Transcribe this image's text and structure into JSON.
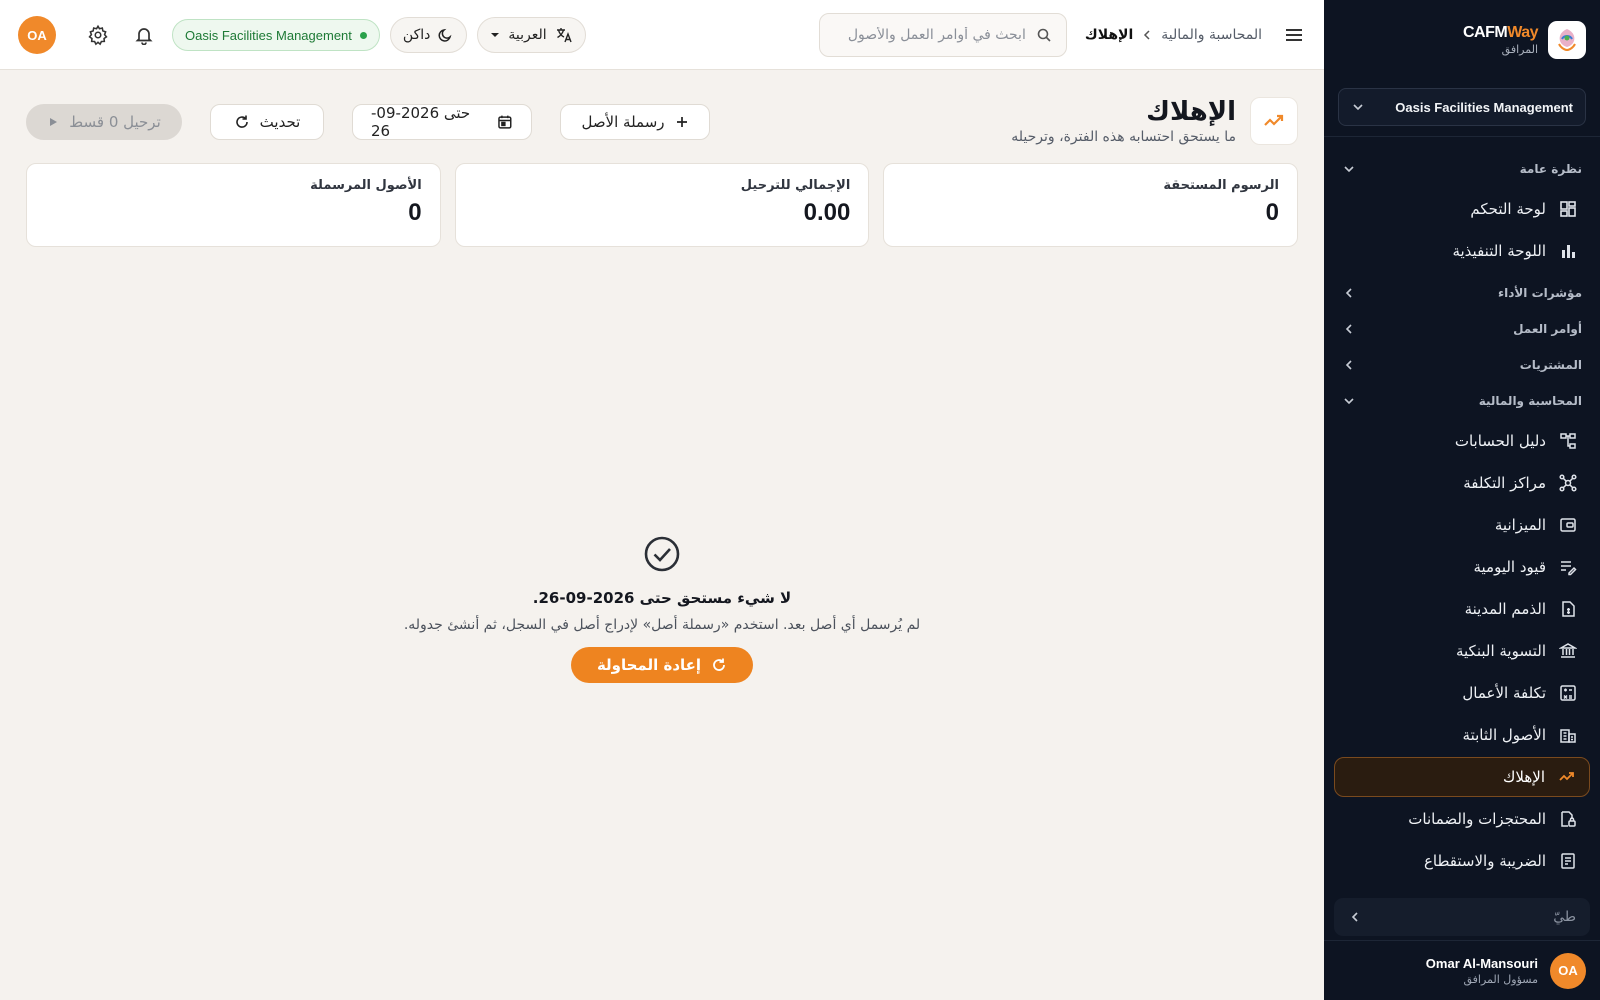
{
  "brand": {
    "name_part1": "CAFM",
    "name_part2": "Way",
    "subtitle": "المرافق"
  },
  "org": {
    "name": "Oasis Facilities Management"
  },
  "sidebar": {
    "sections": {
      "overview": "نظرة عامة",
      "kpis": "مؤشرات الأداء",
      "work_orders": "أوامر العمل",
      "procurement": "المشتريات",
      "accounting": "المحاسبة والمالية"
    },
    "overview_items": [
      {
        "label": "لوحة التحكم",
        "icon": "dashboard-grid-icon"
      },
      {
        "label": "اللوحة التنفيذية",
        "icon": "bar-chart-icon"
      }
    ],
    "accounting_items": [
      {
        "label": "دليل الحسابات",
        "icon": "account-tree-icon"
      },
      {
        "label": "مراكز التكلفة",
        "icon": "hub-network-icon"
      },
      {
        "label": "الميزانية",
        "icon": "wallet-icon"
      },
      {
        "label": "قيود اليومية",
        "icon": "journal-edit-icon"
      },
      {
        "label": "الذمم المدينة",
        "icon": "receivable-doc-icon"
      },
      {
        "label": "التسوية البنكية",
        "icon": "bank-icon"
      },
      {
        "label": "تكلفة الأعمال",
        "icon": "calculator-icon"
      },
      {
        "label": "الأصول الثابتة",
        "icon": "building-icon"
      },
      {
        "label": "الإهلاك",
        "icon": "trending-down-icon",
        "active": true
      },
      {
        "label": "المحتجزات والضمانات",
        "icon": "lock-doc-icon"
      },
      {
        "label": "الضريبة والاستقطاع",
        "icon": "tax-icon"
      }
    ],
    "collapse_label": "طيّ",
    "user": {
      "name": "Omar Al-Mansouri",
      "role": "مسؤول المرافق",
      "initials": "OA"
    }
  },
  "topbar": {
    "breadcrumb_parent": "المحاسبة والمالية",
    "breadcrumb_current": "الإهلاك",
    "search_placeholder": "ابحث في أوامر العمل والأصول ...",
    "language": "العربية",
    "theme": "داكن",
    "org_badge": "Oasis Facilities Management",
    "user_initials": "OA"
  },
  "page": {
    "title": "الإهلاك",
    "subtitle": "ما يستحق احتسابه هذه الفترة، وترحيله",
    "actions": {
      "add_asset": "رسملة الأصل",
      "date_filter": "حتى 2026-09-26",
      "refresh": "تحديث",
      "post": "ترحيل 0 قسط"
    },
    "stats": [
      {
        "label": "الرسوم المستحقة",
        "value": "0"
      },
      {
        "label": "الإجمالي للترحيل",
        "value": "0.00"
      },
      {
        "label": "الأصول المرسملة",
        "value": "0"
      }
    ],
    "empty": {
      "title": "لا شيء مستحق حتى 2026-09-26.",
      "description": "لم يُرسمل أي أصل بعد. استخدم «رسملة أصل» لإدراج أصل في السجل، ثم أنشئ جدوله.",
      "retry": "إعادة المحاولة"
    }
  },
  "colors": {
    "accent": "#ee8420",
    "sidebar_bg": "#0d1422",
    "success": "#2aa14b"
  }
}
